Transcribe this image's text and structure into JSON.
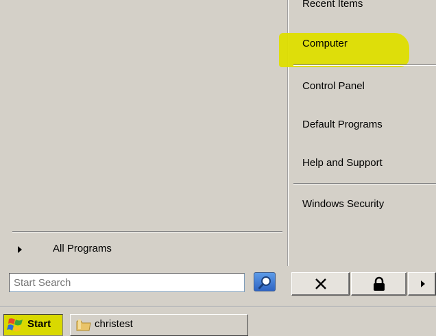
{
  "start_menu": {
    "left_pane": {
      "all_programs_label": "All Programs"
    },
    "right_pane": {
      "items": [
        {
          "label": "Recent Items"
        },
        {
          "label": "Computer"
        },
        {
          "label": "Control Panel"
        },
        {
          "label": "Default Programs"
        },
        {
          "label": "Help and Support"
        },
        {
          "label": "Windows Security"
        }
      ],
      "highlight_color": "#dede00"
    },
    "search": {
      "placeholder": "Start Search",
      "button_icon": "magnifier-icon"
    },
    "power_buttons": {
      "shutdown_icon": "x-icon",
      "lock_icon": "lock-icon",
      "more_icon": "arrow-right-icon"
    }
  },
  "taskbar": {
    "start_label": "Start",
    "start_highlight": "#d9d900",
    "tasks": [
      {
        "label": "christest",
        "icon": "folder-icon"
      }
    ]
  }
}
